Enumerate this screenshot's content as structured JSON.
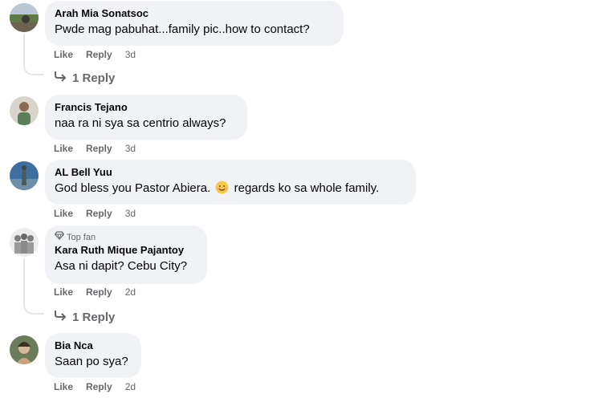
{
  "comments": [
    {
      "author": "Arah Mia Sonatsoc",
      "text": "Pwde mag pabuhat...family pic..how to contact?",
      "like": "Like",
      "reply": "Reply",
      "time": "3d",
      "replies": "1 Reply"
    },
    {
      "author": "Francis Tejano",
      "text": "naa ra ni sya sa centrio always?",
      "like": "Like",
      "reply": "Reply",
      "time": "3d"
    },
    {
      "author": "AL Bell Yuu",
      "text_before": "God bless you Pastor Abiera.",
      "text_after": "regards ko sa whole family.",
      "emoji_icon": "smiling-face-emoji",
      "like": "Like",
      "reply": "Reply",
      "time": "3d"
    },
    {
      "badge": "Top fan",
      "badge_icon": "diamond-icon",
      "author": "Kara Ruth Mique Pajantoy",
      "text": "Asa ni dapit? Cebu City?",
      "like": "Like",
      "reply": "Reply",
      "time": "2d",
      "replies": "1 Reply"
    },
    {
      "author": "Bia Nca",
      "text": "Saan po sya?",
      "like": "Like",
      "reply": "Reply",
      "time": "2d"
    }
  ],
  "colors": {
    "bubble": "#f0f2f5",
    "text": "#050505",
    "meta": "#65676b",
    "thread_line": "#e4e6eb"
  }
}
